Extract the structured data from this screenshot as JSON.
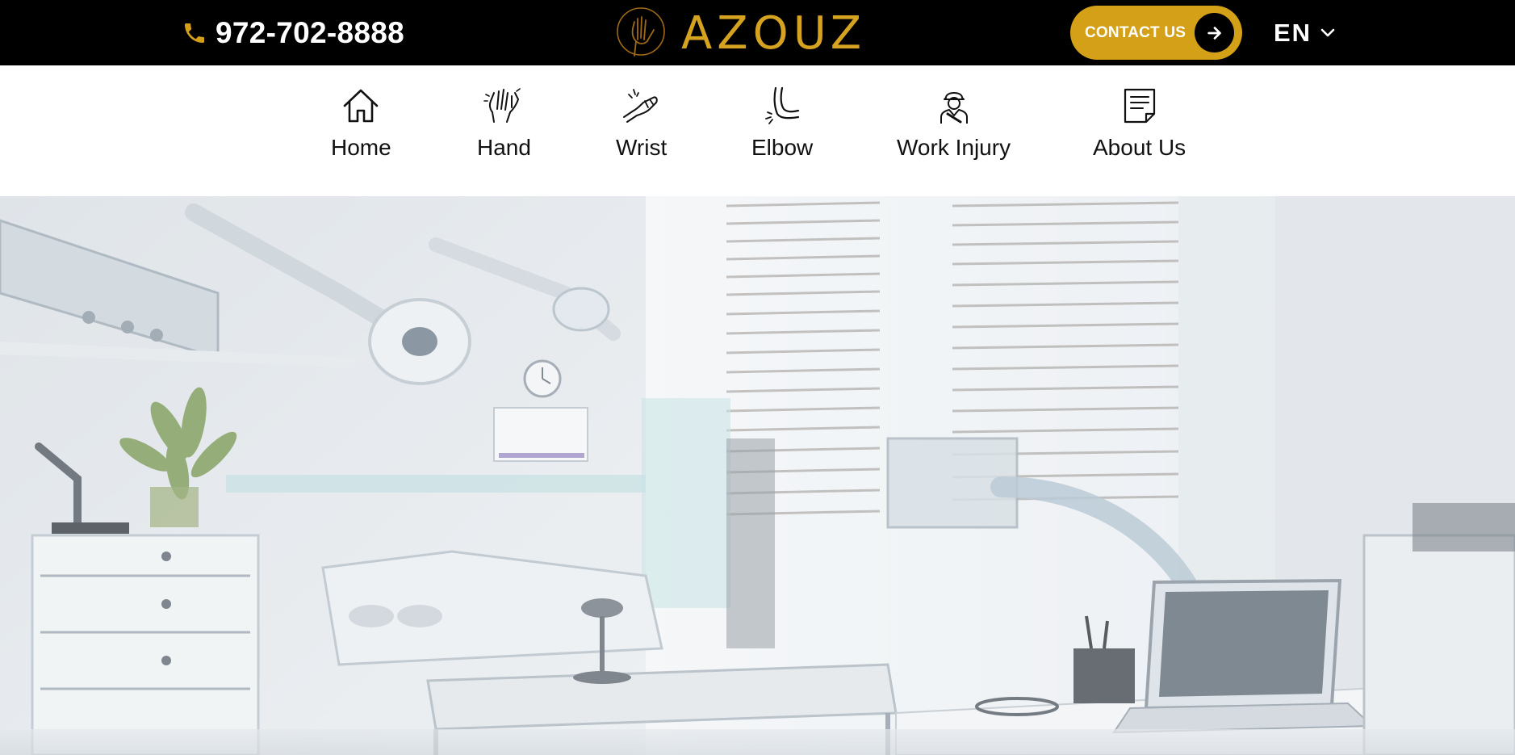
{
  "header": {
    "phone": "972-702-8888",
    "logo_text": "AZOUZ",
    "contact_label": "CONTACT US",
    "language": "EN",
    "icons": [
      "phone-icon",
      "hand-logo-icon",
      "arrow-right-icon",
      "chevron-down-icon"
    ],
    "colors": {
      "bar": "#000000",
      "accent": "#d4a018",
      "text": "#ffffff"
    }
  },
  "nav": {
    "items": [
      {
        "label": "Home",
        "icon": "home-icon"
      },
      {
        "label": "Hand",
        "icon": "hand-icon"
      },
      {
        "label": "Wrist",
        "icon": "wrist-icon"
      },
      {
        "label": "Elbow",
        "icon": "elbow-icon"
      },
      {
        "label": "Work Injury",
        "icon": "work-injury-icon"
      },
      {
        "label": "About Us",
        "icon": "about-document-icon"
      }
    ]
  },
  "hero": {
    "image": "medical-clinic-room-background"
  }
}
